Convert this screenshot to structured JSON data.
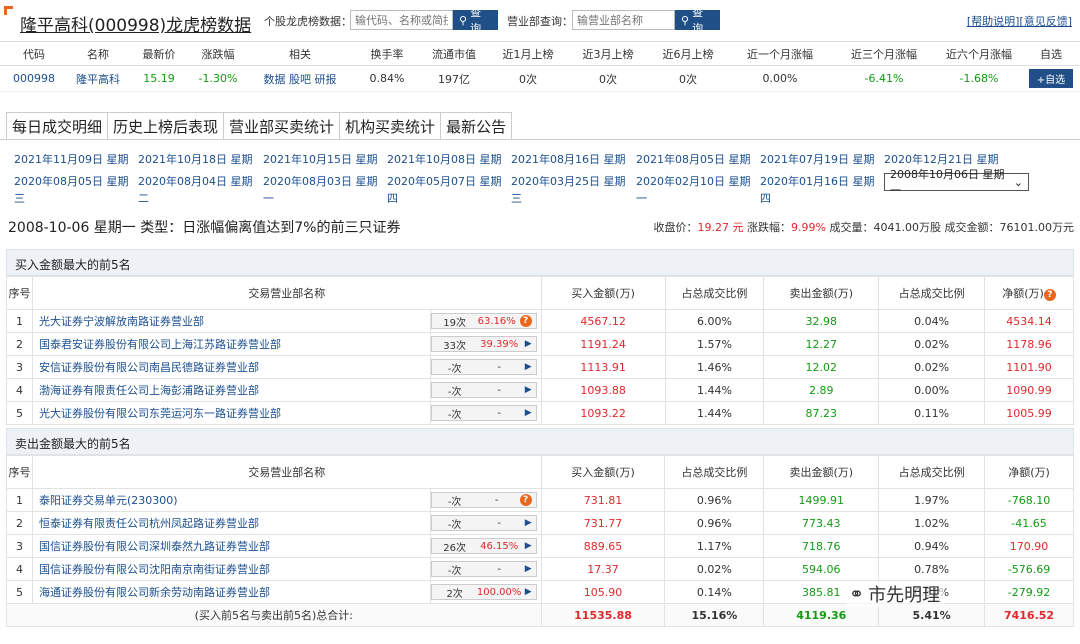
{
  "header": {
    "stock_name": "隆平高科",
    "stock_code": "(000998)",
    "title_suffix": "龙虎榜数据",
    "stock_search_label": "个股龙虎榜数据：",
    "stock_search_placeholder": "输代码、名称或简拼",
    "search_btn": "查询",
    "dept_search_label": "营业部查询：",
    "dept_search_placeholder": "输营业部名称",
    "dept_btn": "查询",
    "help_link": "[帮助说明]",
    "feedback_link": "[意见反馈]"
  },
  "summary": {
    "headers": [
      "代码",
      "名称",
      "最新价",
      "涨跌幅",
      "相关",
      "换手率",
      "流通市值",
      "近1月上榜",
      "近3月上榜",
      "近6月上榜",
      "近一个月涨幅",
      "近三个月涨幅",
      "近六个月涨幅",
      "自选"
    ],
    "code": "000998",
    "name": "隆平高科",
    "price": "15.19",
    "change": "-1.30%",
    "related": [
      "数据",
      "股吧",
      "研报"
    ],
    "turnover": "0.84%",
    "market_value": "197亿",
    "m1": "0次",
    "m3": "0次",
    "m6": "0次",
    "r1": "0.00%",
    "r3": "-6.41%",
    "r6": "-1.68%",
    "add_btn": "+自选"
  },
  "tabs": [
    "每日成交明细",
    "历史上榜后表现",
    "营业部买卖统计",
    "机构买卖统计",
    "最新公告"
  ],
  "dates_row1": [
    "2021年11月09日 星期",
    "2021年10月18日 星期",
    "2021年10月15日 星期",
    "2021年10月08日 星期",
    "2021年08月16日 星期",
    "2021年08月05日 星期",
    "2021年07月19日 星期",
    "2020年12月21日 星期"
  ],
  "dates_row2": [
    "2020年08月05日 星期",
    "2020年08月04日 星期",
    "2020年08月03日 星期",
    "2020年05月07日 星期",
    "2020年03月25日 星期",
    "2020年02月10日 星期",
    "2020年01月16日 星期"
  ],
  "dates_row2_tail": [
    "三",
    "二",
    "一",
    "四",
    "三",
    "一",
    "四"
  ],
  "date_select": "2008年10月06日 星期一",
  "info": {
    "line": "2008-10-06 星期一 类型：日涨幅偏离值达到7%的前三只证券",
    "close_label": "收盘价：",
    "close": "19.27 元",
    "change_label": "涨跌幅：",
    "change": "9.99%",
    "volume_label": "成交量：",
    "volume": "4041.00万股",
    "amount_label": "成交金额：",
    "amount": "76101.00万元"
  },
  "buy_section": {
    "title": "买入金额最大的前5名",
    "rows": [
      {
        "no": "1",
        "name": "光大证券宁波解放南路证券营业部",
        "cnt": "19次",
        "rate": "63.16%",
        "buy": "4567.12",
        "buyp": "6.00%",
        "sell": "32.98",
        "sellp": "0.04%",
        "net": "4534.14"
      },
      {
        "no": "2",
        "name": "国泰君安证券股份有限公司上海江苏路证券营业部",
        "cnt": "33次",
        "rate": "39.39%",
        "buy": "1191.24",
        "buyp": "1.57%",
        "sell": "12.27",
        "sellp": "0.02%",
        "net": "1178.96"
      },
      {
        "no": "3",
        "name": "安信证券股份有限公司南昌民德路证券营业部",
        "cnt": "-次",
        "rate": "-",
        "buy": "1113.91",
        "buyp": "1.46%",
        "sell": "12.02",
        "sellp": "0.02%",
        "net": "1101.90"
      },
      {
        "no": "4",
        "name": "渤海证券有限责任公司上海彭浦路证券营业部",
        "cnt": "-次",
        "rate": "-",
        "buy": "1093.88",
        "buyp": "1.44%",
        "sell": "2.89",
        "sellp": "0.00%",
        "net": "1090.99"
      },
      {
        "no": "5",
        "name": "光大证券股份有限公司东莞运河东一路证券营业部",
        "cnt": "-次",
        "rate": "-",
        "buy": "1093.22",
        "buyp": "1.44%",
        "sell": "87.23",
        "sellp": "0.11%",
        "net": "1005.99"
      }
    ]
  },
  "sell_section": {
    "title": "卖出金额最大的前5名",
    "rows": [
      {
        "no": "1",
        "name": "泰阳证券交易单元(230300)",
        "cnt": "-次",
        "rate": "-",
        "buy": "731.81",
        "buyp": "0.96%",
        "sell": "1499.91",
        "sellp": "1.97%",
        "net": "-768.10"
      },
      {
        "no": "2",
        "name": "恒泰证券有限责任公司杭州凤起路证券营业部",
        "cnt": "-次",
        "rate": "-",
        "buy": "731.77",
        "buyp": "0.96%",
        "sell": "773.43",
        "sellp": "1.02%",
        "net": "-41.65"
      },
      {
        "no": "3",
        "name": "国信证券股份有限公司深圳泰然九路证券营业部",
        "cnt": "26次",
        "rate": "46.15%",
        "buy": "889.65",
        "buyp": "1.17%",
        "sell": "718.76",
        "sellp": "0.94%",
        "net": "170.90"
      },
      {
        "no": "4",
        "name": "国信证券股份有限公司沈阳南京南街证券营业部",
        "cnt": "-次",
        "rate": "-",
        "buy": "17.37",
        "buyp": "0.02%",
        "sell": "594.06",
        "sellp": "0.78%",
        "net": "-576.69"
      },
      {
        "no": "5",
        "name": "海通证券股份有限公司新余劳动南路证券营业部",
        "cnt": "2次",
        "rate": "100.00%",
        "buy": "105.90",
        "buyp": "0.14%",
        "sell": "385.81",
        "sellp": "0.51%",
        "net": "-279.92"
      }
    ]
  },
  "table_headers": [
    "序号",
    "交易营业部名称",
    "买入金额(万)",
    "占总成交比例",
    "卖出金额(万)",
    "占总成交比例",
    "净额(万)"
  ],
  "totals": {
    "label": "(买入前5名与卖出前5名)总合计:",
    "buy": "11535.88",
    "buyp": "15.16%",
    "sell": "4119.36",
    "sellp": "5.41%",
    "net": "7416.52"
  },
  "watermark": "市先明理",
  "colors": {
    "accent": "#1f4f86",
    "up": "#e0292b",
    "down": "#139b13",
    "corner": "#e9671d"
  }
}
